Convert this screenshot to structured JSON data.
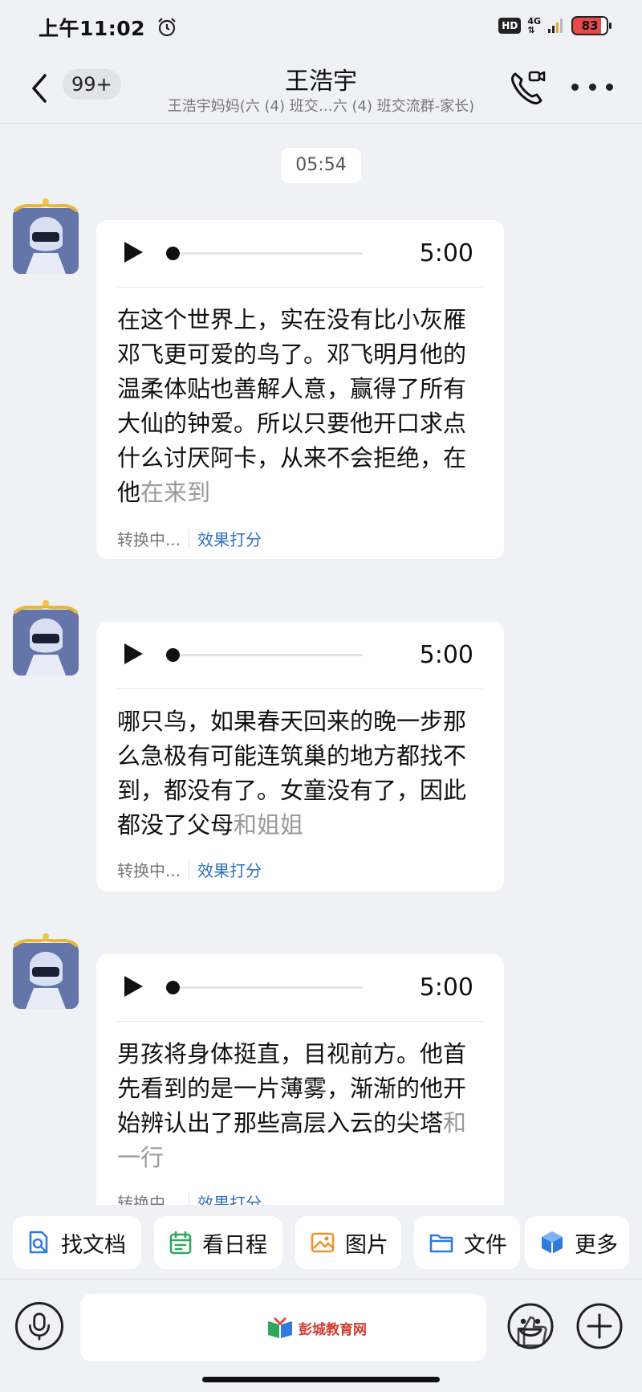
{
  "status_bar": {
    "time": "上午11:02",
    "hd": "HD",
    "network": "4G",
    "battery": "83"
  },
  "header": {
    "unread_count": "99+",
    "title": "王浩宇",
    "subtitle": "王浩宇妈妈(六 (4) 班交…六 (4) 班交流群-家长)"
  },
  "timestamp": "05:54",
  "messages": [
    {
      "duration": "5:00",
      "transcript_final": "在这个世界上，实在没有比小灰雁邓飞更可爱的鸟了。邓飞明月他的温柔体贴也善解人意，赢得了所有大仙的钟爱。所以只要他开口求点什么讨厌阿卡，从来不会拒绝，在他",
      "transcript_pending": "在来到",
      "status": "转换中...",
      "rate_link": "效果打分"
    },
    {
      "duration": "5:00",
      "transcript_final": "哪只鸟，如果春天回来的晚一步那么急极有可能连筑巢的地方都找不到，都没有了。女童没有了，因此都没了父母",
      "transcript_pending": "和姐姐",
      "status": "转换中...",
      "rate_link": "效果打分"
    },
    {
      "duration": "5:00",
      "transcript_final": "男孩将身体挺直，目视前方。他首先看到的是一片薄雾，渐渐的他开始辨认出了那些高层入云的尖塔",
      "transcript_pending": "和一行",
      "status": "转换中...",
      "rate_link": "效果打分"
    }
  ],
  "quick_actions": [
    {
      "label": "找文档",
      "icon": "doc-search-icon"
    },
    {
      "label": "看日程",
      "icon": "calendar-icon"
    },
    {
      "label": "图片",
      "icon": "image-icon"
    },
    {
      "label": "文件",
      "icon": "folder-icon"
    },
    {
      "label": "更多",
      "icon": "apps-icon"
    }
  ],
  "watermark": "彭城教育网",
  "colors": {
    "background": "#f0f1f5",
    "link": "#2f6fbf",
    "pending_text": "#9a9a9a"
  }
}
